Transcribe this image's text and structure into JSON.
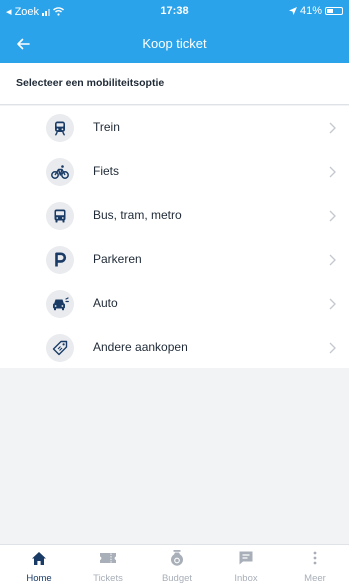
{
  "status": {
    "carrier": "◂ Zoek",
    "time": "17:38",
    "battery": "41%"
  },
  "nav": {
    "title": "Koop ticket"
  },
  "section": {
    "title": "Selecteer een mobiliteitsoptie"
  },
  "options": [
    {
      "label": "Trein",
      "icon": "train-icon"
    },
    {
      "label": "Fiets",
      "icon": "bicycle-icon"
    },
    {
      "label": "Bus, tram, metro",
      "icon": "bus-icon"
    },
    {
      "label": "Parkeren",
      "icon": "parking-icon"
    },
    {
      "label": "Auto",
      "icon": "car-icon"
    },
    {
      "label": "Andere aankopen",
      "icon": "tag-icon"
    }
  ],
  "tabs": [
    {
      "label": "Home",
      "icon": "home-icon",
      "active": true
    },
    {
      "label": "Tickets",
      "icon": "ticket-icon",
      "active": false
    },
    {
      "label": "Budget",
      "icon": "money-bag-icon",
      "active": false
    },
    {
      "label": "Inbox",
      "icon": "message-icon",
      "active": false
    },
    {
      "label": "Meer",
      "icon": "more-icon",
      "active": false
    }
  ],
  "colors": {
    "header": "#2ba3ea",
    "active_tab": "#1a3b66",
    "inactive_tab": "#a8afb8",
    "icon": "#1a3b66"
  }
}
